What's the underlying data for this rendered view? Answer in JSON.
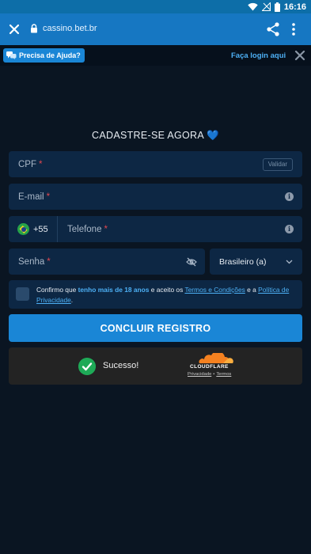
{
  "status_bar": {
    "time": "16:16"
  },
  "browser_bar": {
    "url": "cassino.bet.br"
  },
  "top_strip": {
    "help_label": "Precisa de Ajuda?",
    "login_label": "Faça login aqui"
  },
  "form": {
    "title": "CADASTRE-SE AGORA",
    "title_emoji": "💙",
    "cpf": {
      "label": "CPF",
      "required_mark": "*",
      "validate_label": "Validar"
    },
    "email": {
      "label": "E-mail",
      "required_mark": "*"
    },
    "phone": {
      "country_code": "+55",
      "label": "Telefone",
      "required_mark": "*"
    },
    "password": {
      "label": "Senha",
      "required_mark": "*"
    },
    "nationality": {
      "selected": "Brasileiro (a)"
    },
    "consent": {
      "prefix": "Confirmo que",
      "highlight": "tenho mais de 18 anos",
      "middle": "e aceito os",
      "terms_link": "Termos e Condições",
      "and": "e a",
      "privacy_link": "Política de Privacidade",
      "suffix": "."
    },
    "submit_label": "CONCLUIR REGISTRO"
  },
  "captcha": {
    "status": "Sucesso!",
    "provider": "CLOUDFLARE",
    "privacy_link": "Privacidade",
    "separator": "•",
    "terms_link": "Termos"
  },
  "colors": {
    "background": "#0a1522",
    "browser_bar": "#1677c2",
    "accent": "#1a86d6",
    "field_bg": "#0d2744",
    "required": "#e2474f",
    "success": "#1eaa57",
    "cloudflare_orange": "#f48120"
  },
  "icons": [
    "wifi-icon",
    "no-signal-icon",
    "battery-icon",
    "close-icon",
    "lock-icon",
    "share-icon",
    "more-vert-icon",
    "chat-bubble-icon",
    "info-icon",
    "eye-off-icon",
    "chevron-down-icon",
    "brazil-flag-icon",
    "check-circle-icon",
    "cloudflare-logo"
  ]
}
